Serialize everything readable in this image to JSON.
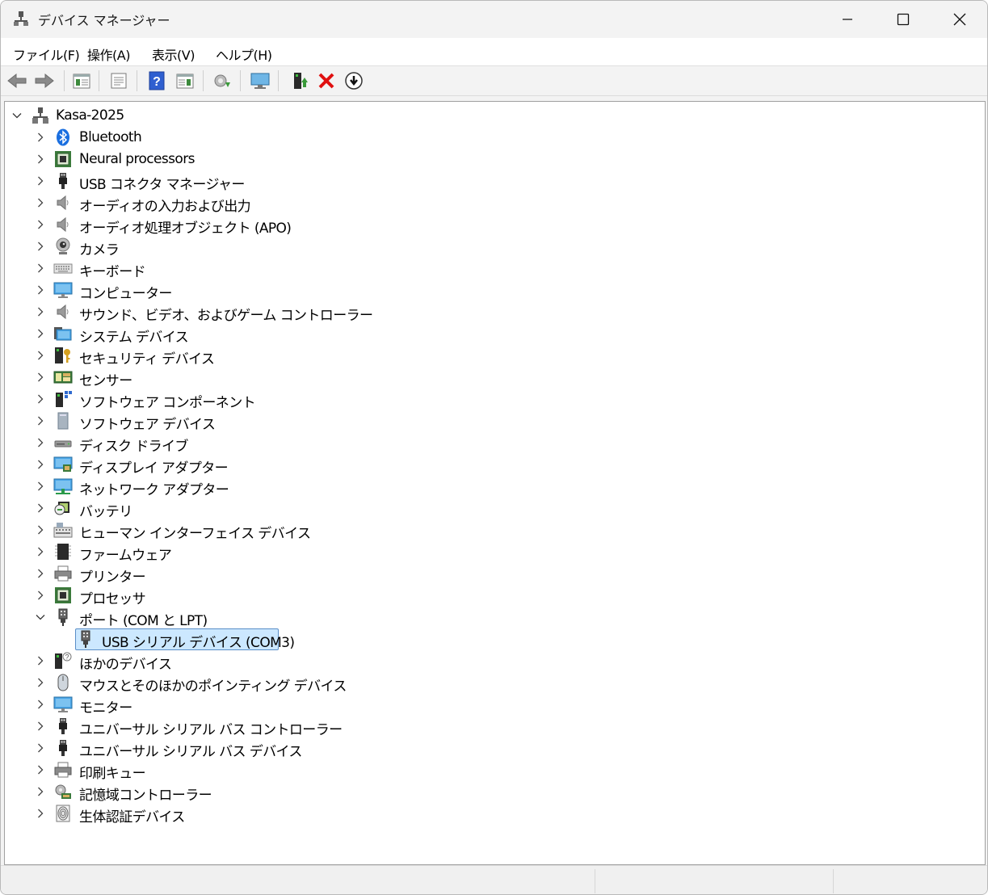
{
  "window": {
    "title": "デバイス マネージャー"
  },
  "menu": [
    "ファイル(F)",
    "操作(A)",
    "表示(V)",
    "ヘルプ(H)"
  ],
  "toolbar": [
    {
      "name": "back-button",
      "icon": "arrow-left-icon"
    },
    {
      "name": "forward-button",
      "icon": "arrow-right-icon"
    },
    {
      "name": "show-hide-console-tree-button",
      "icon": "console-tree-icon"
    },
    {
      "name": "properties-button",
      "icon": "properties-icon"
    },
    {
      "name": "help-button",
      "icon": "help-icon"
    },
    {
      "name": "show-action-pane-button",
      "icon": "action-pane-icon"
    },
    {
      "name": "update-driver-button",
      "icon": "update-driver-icon"
    },
    {
      "name": "scan-hardware-button",
      "icon": "scan-hardware-icon"
    },
    {
      "name": "enable-device-button",
      "icon": "enable-device-icon"
    },
    {
      "name": "uninstall-device-button",
      "icon": "red-x-icon"
    },
    {
      "name": "disable-device-button",
      "icon": "disable-device-icon"
    }
  ],
  "tree": {
    "root": "Kasa-2025",
    "items": [
      {
        "label": "Bluetooth",
        "icon": "bluetooth-icon"
      },
      {
        "label": "Neural processors",
        "icon": "chip-icon"
      },
      {
        "label": "USB コネクタ マネージャー",
        "icon": "usb-plug-icon"
      },
      {
        "label": "オーディオの入力および出力",
        "icon": "speaker-icon"
      },
      {
        "label": "オーディオ処理オブジェクト (APO)",
        "icon": "speaker-icon"
      },
      {
        "label": "カメラ",
        "icon": "camera-icon"
      },
      {
        "label": "キーボード",
        "icon": "keyboard-icon"
      },
      {
        "label": "コンピューター",
        "icon": "monitor-icon"
      },
      {
        "label": "サウンド、ビデオ、およびゲーム コントローラー",
        "icon": "speaker-icon"
      },
      {
        "label": "システム デバイス",
        "icon": "system-folder-icon"
      },
      {
        "label": "セキュリティ デバイス",
        "icon": "security-key-icon"
      },
      {
        "label": "センサー",
        "icon": "sensor-icon"
      },
      {
        "label": "ソフトウェア コンポーネント",
        "icon": "software-component-icon"
      },
      {
        "label": "ソフトウェア デバイス",
        "icon": "software-device-icon"
      },
      {
        "label": "ディスク ドライブ",
        "icon": "disk-drive-icon"
      },
      {
        "label": "ディスプレイ アダプター",
        "icon": "display-adapter-icon"
      },
      {
        "label": "ネットワーク アダプター",
        "icon": "network-adapter-icon"
      },
      {
        "label": "バッテリ",
        "icon": "battery-icon"
      },
      {
        "label": "ヒューマン インターフェイス デバイス",
        "icon": "hid-icon"
      },
      {
        "label": "ファームウェア",
        "icon": "firmware-icon"
      },
      {
        "label": "プリンター",
        "icon": "printer-icon"
      },
      {
        "label": "プロセッサ",
        "icon": "chip-icon"
      },
      {
        "label": "ポート (COM と LPT)",
        "icon": "port-icon",
        "expanded": true
      },
      {
        "label": "USB シリアル デバイス (COM3)",
        "icon": "port-icon",
        "child": true,
        "selected": true
      },
      {
        "label": "ほかのデバイス",
        "icon": "unknown-device-icon"
      },
      {
        "label": "マウスとそのほかのポインティング デバイス",
        "icon": "mouse-icon"
      },
      {
        "label": "モニター",
        "icon": "monitor-icon"
      },
      {
        "label": "ユニバーサル シリアル バス コントローラー",
        "icon": "usb-plug-icon"
      },
      {
        "label": "ユニバーサル シリアル バス デバイス",
        "icon": "usb-plug-icon"
      },
      {
        "label": "印刷キュー",
        "icon": "printer-icon"
      },
      {
        "label": "記憶域コントローラー",
        "icon": "storage-controller-icon"
      },
      {
        "label": "生体認証デバイス",
        "icon": "fingerprint-icon"
      }
    ]
  }
}
